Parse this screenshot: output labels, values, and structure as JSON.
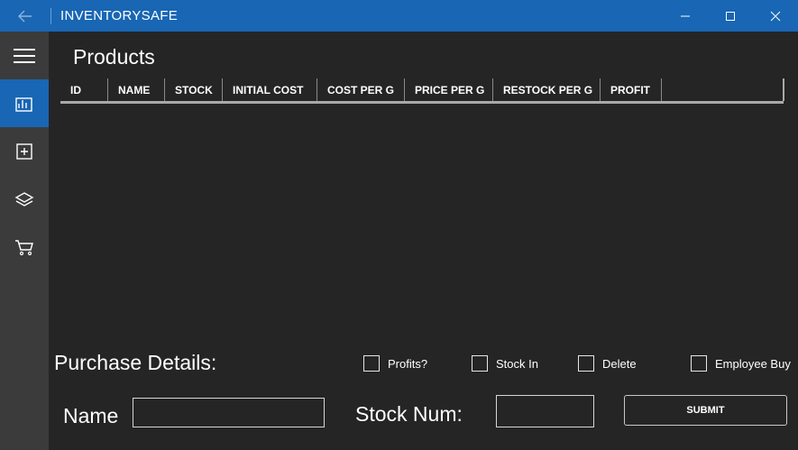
{
  "app": {
    "title": "INVENTORYSAFE"
  },
  "sidebar": {
    "items": [
      {
        "name": "menu",
        "icon": "hamburger-icon"
      },
      {
        "name": "products",
        "icon": "products-icon",
        "active": true
      },
      {
        "name": "add",
        "icon": "add-box-icon"
      },
      {
        "name": "layers",
        "icon": "layers-icon"
      },
      {
        "name": "cart",
        "icon": "cart-icon"
      }
    ]
  },
  "main": {
    "title": "Products",
    "columns": [
      "ID",
      "NAME",
      "STOCK",
      "INITIAL COST",
      "COST PER G",
      "PRICE PER G",
      "RESTOCK PER G",
      "PROFIT"
    ],
    "rows": []
  },
  "purchase": {
    "label": "Purchase Details:",
    "checkboxes": {
      "profits": "Profits?",
      "stock_in": "Stock In",
      "delete": "Delete",
      "employee_buy": "Employee Buy"
    },
    "name_label": "Name",
    "name_value": "",
    "stock_label": "Stock Num:",
    "stock_value": "",
    "submit_label": "SUBMIT"
  },
  "colors": {
    "accent": "#1866b4",
    "background": "#252525",
    "sidebar": "#3b3b3b"
  }
}
